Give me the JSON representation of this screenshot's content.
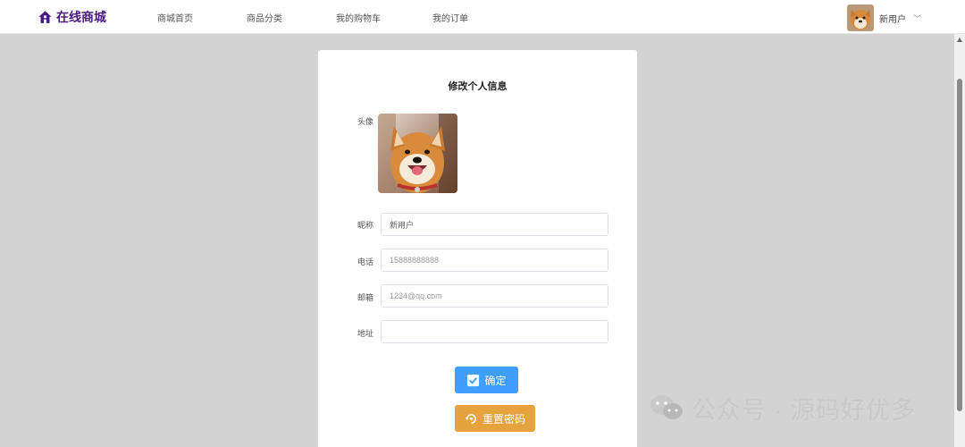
{
  "header": {
    "logo_text": "在线商城",
    "nav": [
      {
        "label": "商城首页"
      },
      {
        "label": "商品分类"
      },
      {
        "label": "我的购物车"
      },
      {
        "label": "我的订单"
      }
    ],
    "user": {
      "name": "新用户"
    }
  },
  "form": {
    "title": "修改个人信息",
    "avatar_label": "头像",
    "nickname": {
      "label": "昵称",
      "value": "新用户"
    },
    "phone": {
      "label": "电话",
      "placeholder": "15888888888"
    },
    "email": {
      "label": "邮箱",
      "placeholder": "1234@qq.com"
    },
    "address": {
      "label": "地址",
      "value": ""
    },
    "confirm_label": "确定",
    "reset_label": "重置密码"
  },
  "watermark": {
    "text": "公众号 · 源码好优多"
  },
  "colors": {
    "primary": "#409eff",
    "warning": "#e6a23c",
    "brand": "#4b1a7f",
    "page_bg": "#d3d3d3"
  },
  "icons": {
    "logo": "house-icon",
    "user_menu": "chevron-down-icon",
    "confirm": "check-square-icon",
    "reset": "refresh-icon",
    "watermark": "wechat-icon"
  }
}
